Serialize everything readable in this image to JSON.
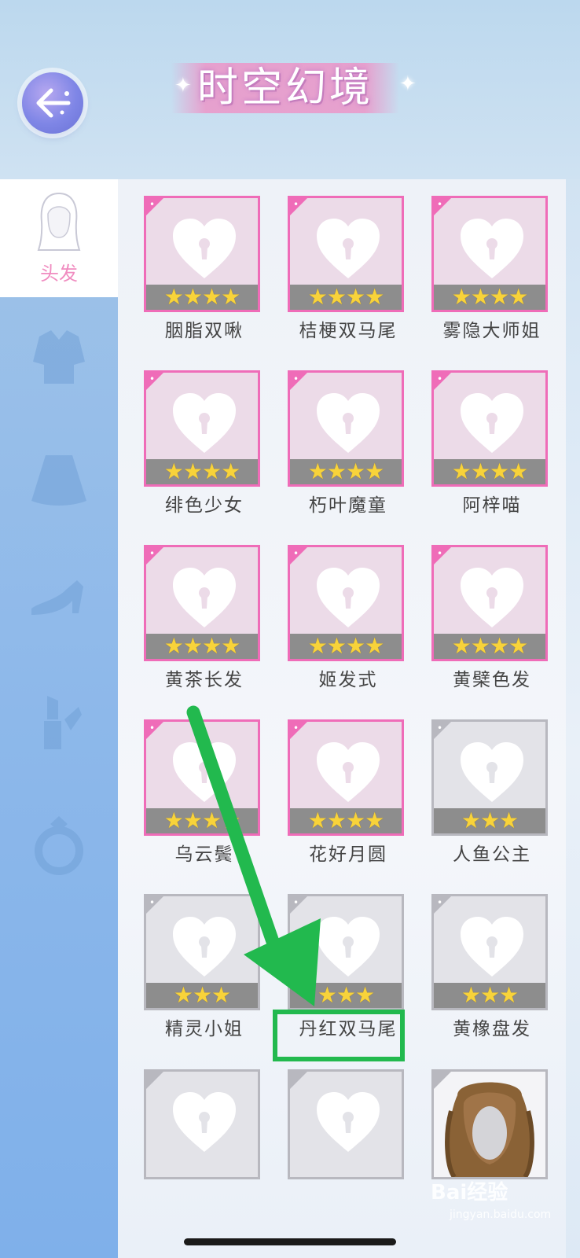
{
  "header": {
    "title": "时空幻境"
  },
  "sidebar": {
    "active_tab_label": "头发",
    "tabs": [
      "hair-icon",
      "top-icon",
      "skirt-icon",
      "shoe-icon",
      "lipstick-icon",
      "ring-icon"
    ]
  },
  "items": [
    {
      "name": "胭脂双啾",
      "stars": "★★★★",
      "rarity": "pink"
    },
    {
      "name": "桔梗双马尾",
      "stars": "★★★★",
      "rarity": "pink"
    },
    {
      "name": "雾隐大师姐",
      "stars": "★★★★",
      "rarity": "pink"
    },
    {
      "name": "绯色少女",
      "stars": "★★★★",
      "rarity": "pink"
    },
    {
      "name": "朽叶魔童",
      "stars": "★★★★",
      "rarity": "pink"
    },
    {
      "name": "阿梓喵",
      "stars": "★★★★",
      "rarity": "pink"
    },
    {
      "name": "黄茶长发",
      "stars": "★★★★",
      "rarity": "pink"
    },
    {
      "name": "姬发式",
      "stars": "★★★★",
      "rarity": "pink"
    },
    {
      "name": "黄檗色发",
      "stars": "★★★★",
      "rarity": "pink"
    },
    {
      "name": "乌云鬓",
      "stars": "★★★★",
      "rarity": "pink"
    },
    {
      "name": "花好月圆",
      "stars": "★★★★",
      "rarity": "pink"
    },
    {
      "name": "人鱼公主",
      "stars": "★★★",
      "rarity": "gray"
    },
    {
      "name": "精灵小姐",
      "stars": "★★★",
      "rarity": "gray"
    },
    {
      "name": "丹红双马尾",
      "stars": "★★★",
      "rarity": "gray"
    },
    {
      "name": "黄橡盘发",
      "stars": "★★★",
      "rarity": "gray"
    }
  ],
  "watermark": {
    "brand": "Bai经验",
    "site": "jingyan.baidu.com"
  },
  "colors": {
    "pink_border": "#ef6cb8",
    "gray_border": "#b8b8bf",
    "highlight": "#22b94e",
    "arrow": "#22b94e"
  }
}
